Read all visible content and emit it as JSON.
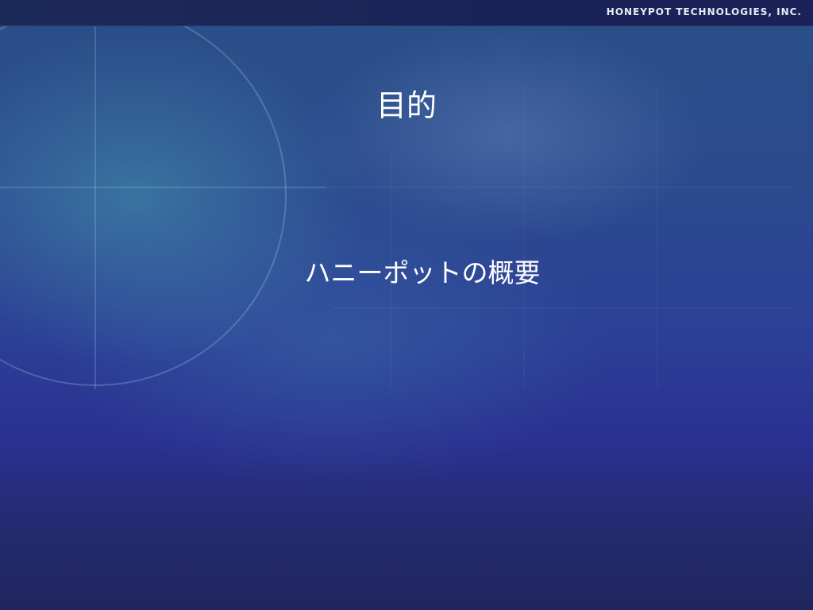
{
  "header": {
    "company": "HONEYPOT TECHNOLOGIES, INC."
  },
  "slide": {
    "title": "目的",
    "body": "ハニーポットの概要"
  },
  "colors": {
    "background_top": "#2a4f86",
    "background_bottom": "#1f265e",
    "text": "#ffffff"
  }
}
